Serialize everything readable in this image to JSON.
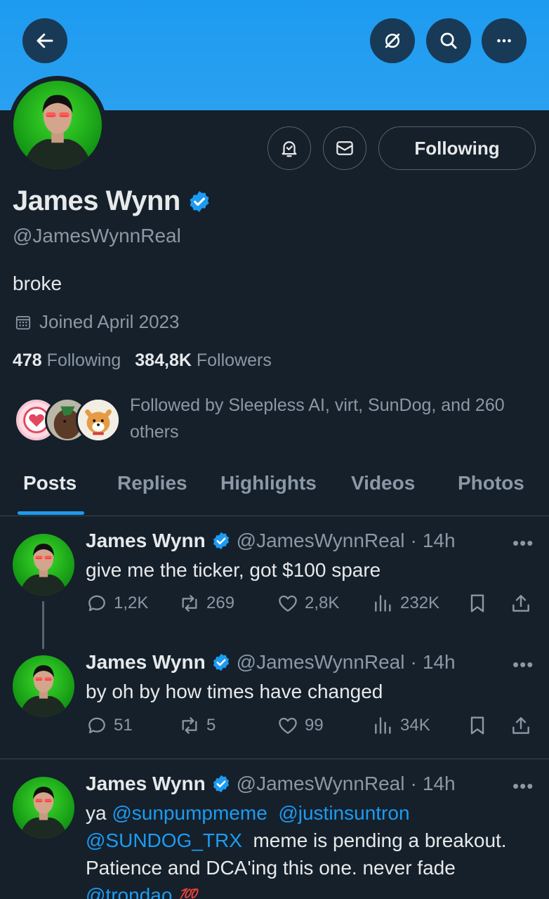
{
  "profile": {
    "name": "James Wynn",
    "handle": "@JamesWynnReal",
    "bio": "broke",
    "joined": "Joined April 2023",
    "following_count": "478",
    "following_label": "Following",
    "followers_count": "384,8K",
    "followers_label": "Followers",
    "followed_by": "Followed by Sleepless AI, virt, SunDog, and 260 others",
    "follow_button": "Following"
  },
  "icons": {
    "back": "back-arrow-icon",
    "grok": "grok-icon",
    "search": "search-icon",
    "more": "more-icon",
    "notify": "bell-icon",
    "message": "mail-icon",
    "verified": "verified-badge-icon",
    "calendar": "calendar-icon"
  },
  "colors": {
    "accent": "#1d9bf0",
    "background": "#15202b",
    "muted": "#8b98a5"
  },
  "tabs": [
    {
      "label": "Posts",
      "active": true
    },
    {
      "label": "Replies",
      "active": false
    },
    {
      "label": "Highlights",
      "active": false
    },
    {
      "label": "Videos",
      "active": false
    },
    {
      "label": "Photos",
      "active": false
    }
  ],
  "posts": [
    {
      "name": "James Wynn",
      "handle": "@JamesWynnReal",
      "dot": "·",
      "time": "14h",
      "text": "give me the ticker, got $100 spare",
      "replies": "1,2K",
      "reposts": "269",
      "likes": "2,8K",
      "views": "232K"
    },
    {
      "name": "James Wynn",
      "handle": "@JamesWynnReal",
      "dot": "·",
      "time": "14h",
      "text": "by oh by how times have changed",
      "replies": "51",
      "reposts": "5",
      "likes": "99",
      "views": "34K"
    },
    {
      "name": "James Wynn",
      "handle": "@JamesWynnReal",
      "dot": "·",
      "time": "14h",
      "text_prefix": "ya ",
      "mention1": "@sunpumpmeme",
      "mention2": "@justinsuntron",
      "mention3": "@SUNDOG_TRX",
      "text_middle": " meme is pending a breakout. Patience and DCA'ing this one. never fade ",
      "mention4": "@trondao",
      "emoji": "💯"
    }
  ]
}
